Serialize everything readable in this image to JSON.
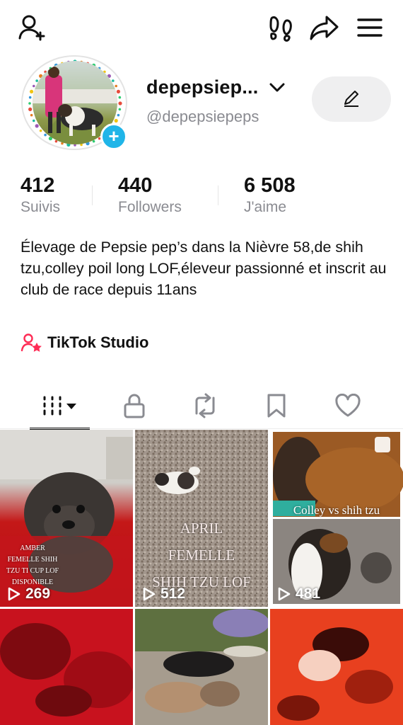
{
  "header": {
    "add_friend_icon": "person-plus-icon",
    "footprints_icon": "footprints-icon",
    "share_icon": "share-arrow-icon",
    "menu_icon": "hamburger-menu-icon"
  },
  "profile": {
    "display_name": "depepsiep...",
    "handle": "@depepsiepeps",
    "edit_icon": "pencil-icon"
  },
  "stats": [
    {
      "value": "412",
      "label": "Suivis"
    },
    {
      "value": "440",
      "label": "Followers"
    },
    {
      "value": "6 508",
      "label": "J'aime"
    }
  ],
  "bio": "Élevage de Pepsie pep’s dans la Nièvre 58,de shih tzu,colley poil long LOF,éleveur passionné et inscrit au club de race depuis 11ans",
  "studio": {
    "label": "TikTok Studio",
    "icon": "person-star-icon"
  },
  "tabs": [
    {
      "name": "videos",
      "icon": "grid-bars-icon"
    },
    {
      "name": "private",
      "icon": "lock-icon"
    },
    {
      "name": "reposts",
      "icon": "repost-icon"
    },
    {
      "name": "favorites",
      "icon": "bookmark-icon"
    },
    {
      "name": "liked",
      "icon": "heart-icon"
    }
  ],
  "videos": [
    {
      "views": "269",
      "overlay": "AMBER FEMELLE SHIH TZU TI CUP LOF DISPONIBLE"
    },
    {
      "views": "512",
      "overlay": "APRIL FEMELLE SHIH TZU LOF"
    },
    {
      "views": "481",
      "overlay": "Colley vs shih tzu"
    },
    {
      "views": ""
    },
    {
      "views": ""
    },
    {
      "views": ""
    }
  ],
  "colors": {
    "accent_blue": "#20b5e8",
    "studio_pink": "#fe2c55",
    "muted_text": "#8a8b91"
  }
}
